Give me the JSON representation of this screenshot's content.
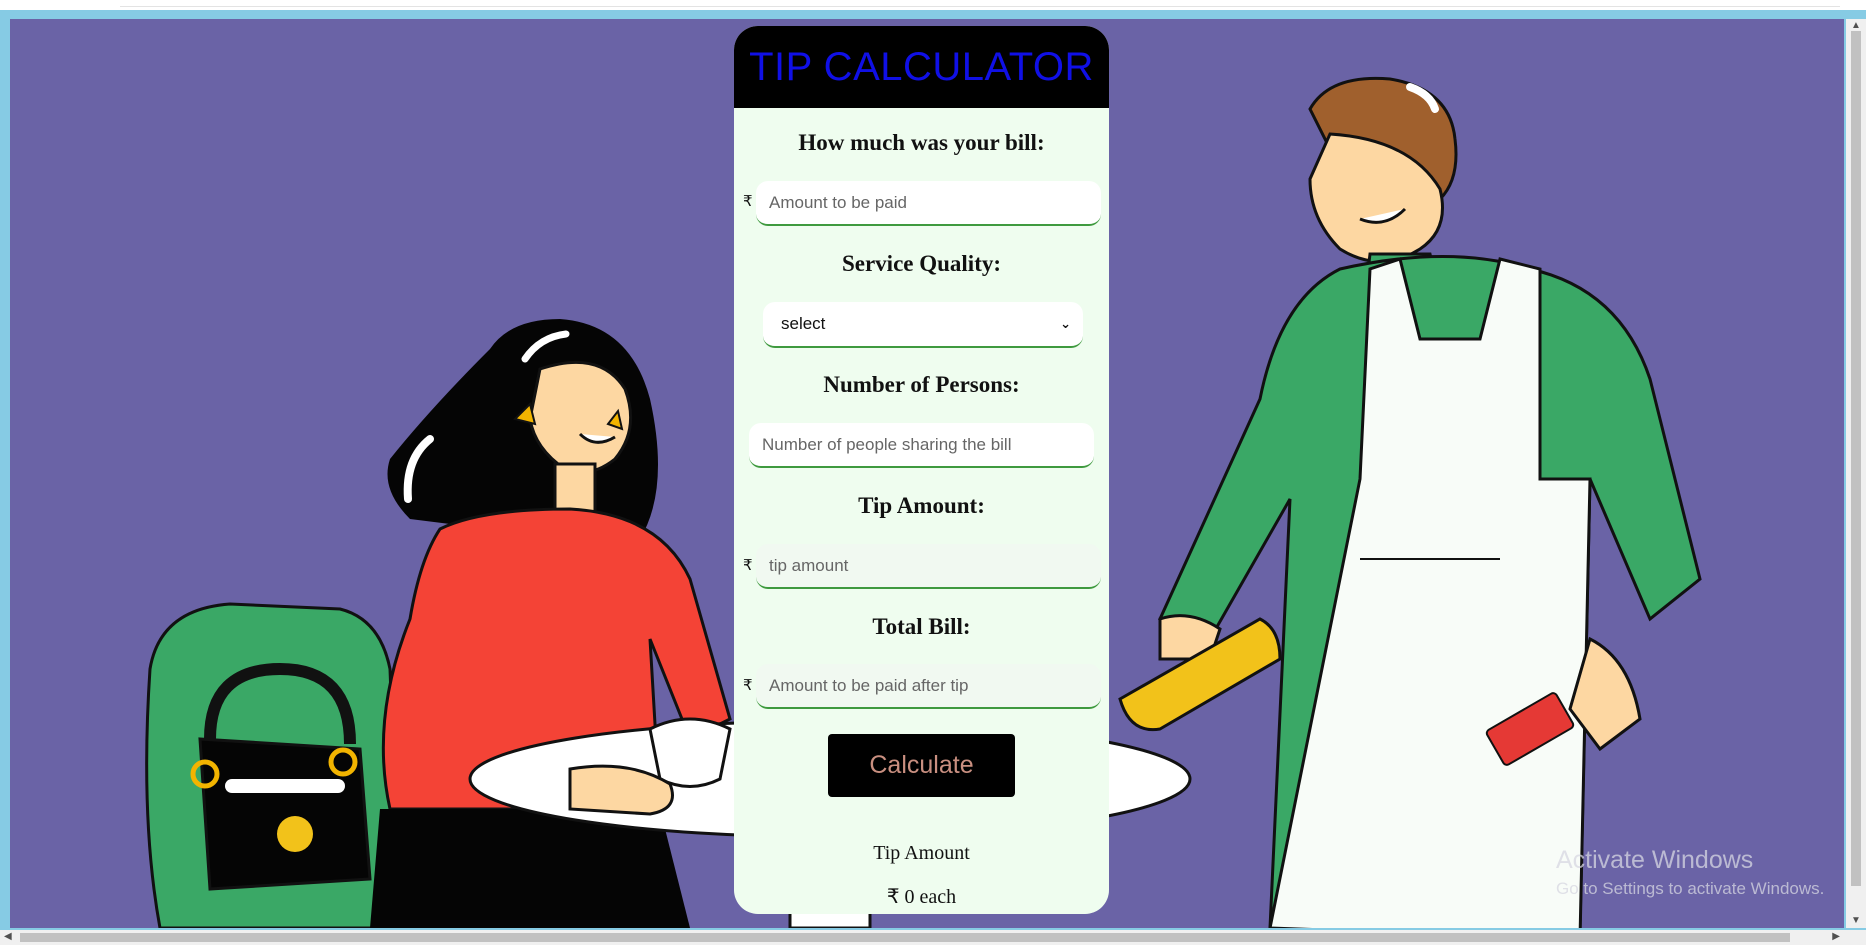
{
  "app": {
    "title": "TIP CALCULATOR"
  },
  "bill": {
    "label": "How much was your bill:",
    "currency": "₹",
    "placeholder": "Amount to be paid"
  },
  "service": {
    "label": "Service Quality:",
    "selected": "select"
  },
  "persons": {
    "label": "Number of Persons:",
    "placeholder": "Number of people sharing the bill"
  },
  "tip": {
    "label": "Tip Amount:",
    "currency": "₹",
    "placeholder": "tip amount"
  },
  "total": {
    "label": "Total Bill:",
    "currency": "₹",
    "placeholder": "Amount to be paid after tip"
  },
  "actions": {
    "calculate_label": "Calculate"
  },
  "result": {
    "label": "Tip Amount",
    "value": "₹ 0 each"
  },
  "watermark": {
    "line1": "Activate Windows",
    "line2": "Go to Settings to activate Windows."
  },
  "colors": {
    "background": "#6a63a6",
    "card": "#effdef",
    "header": "#000000",
    "title": "#1010e6",
    "button_text": "#c98f80",
    "input_border": "#3f9a3f"
  },
  "icons": {
    "select_arrow": "chevron-down-icon"
  }
}
